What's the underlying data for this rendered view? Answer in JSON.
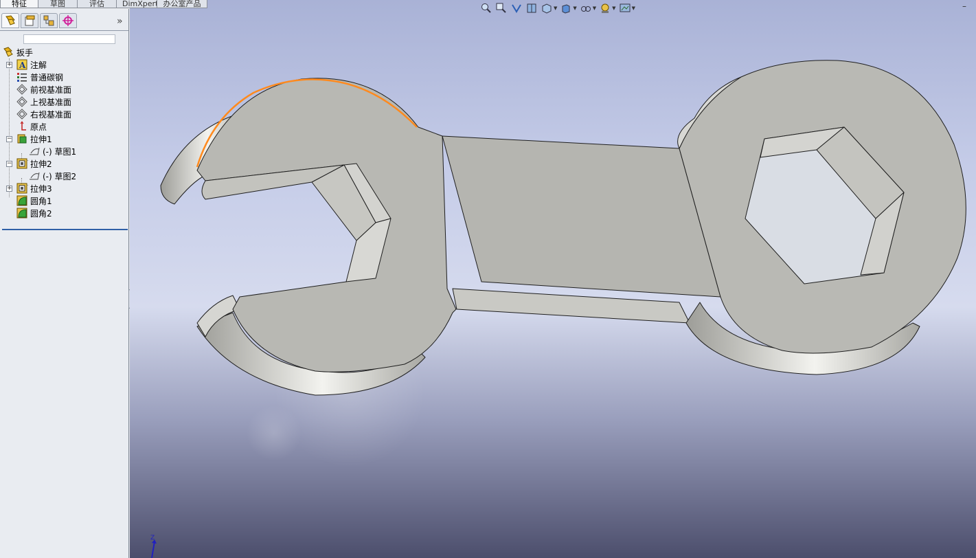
{
  "command_tabs": [
    {
      "label": "特征",
      "active": true
    },
    {
      "label": "草图",
      "active": false
    },
    {
      "label": "评估",
      "active": false
    },
    {
      "label": "DimXpert",
      "active": false
    },
    {
      "label": "办公室产品",
      "active": false
    }
  ],
  "panel": {
    "tabs": [
      "feature-manager-icon",
      "property-manager-icon",
      "configuration-manager-icon",
      "dimxpert-manager-icon"
    ],
    "expand_icon": "»"
  },
  "tree": {
    "root": "扳手",
    "items": [
      {
        "label": "注解",
        "icon": "annotation-icon",
        "expander": "+"
      },
      {
        "label": "普通碳钢",
        "icon": "material-icon"
      },
      {
        "label": "前视基准面",
        "icon": "plane-icon"
      },
      {
        "label": "上视基准面",
        "icon": "plane-icon"
      },
      {
        "label": "右视基准面",
        "icon": "plane-icon"
      },
      {
        "label": "原点",
        "icon": "origin-icon"
      },
      {
        "label": "拉伸1",
        "icon": "extrude-icon",
        "expander": "−"
      },
      {
        "label": "(-)  草图1",
        "icon": "sketch-icon"
      },
      {
        "label": "拉伸2",
        "icon": "extrude-cut-icon",
        "expander": "−"
      },
      {
        "label": "(-)  草图2",
        "icon": "sketch-icon"
      },
      {
        "label": "拉伸3",
        "icon": "extrude-cut-icon",
        "expander": "+"
      },
      {
        "label": "圆角1",
        "icon": "fillet-icon"
      },
      {
        "label": "圆角2",
        "icon": "fillet-icon"
      }
    ]
  },
  "view_toolbar": [
    "zoom-to-fit-icon",
    "zoom-area-icon",
    "previous-view-icon",
    "section-view-icon",
    "view-orientation-icon",
    "display-style-icon",
    "hide-show-icon",
    "appearance-icon",
    "scene-icon"
  ],
  "window_controls": {
    "minimize": "–"
  },
  "triad": {
    "z_label": "Z"
  },
  "colors": {
    "model_face": "#b9b9b4",
    "model_edge": "#1e1e1e",
    "highlight_edge": "#ff8a1e",
    "tree_end_bar": "#2f5fa6"
  }
}
